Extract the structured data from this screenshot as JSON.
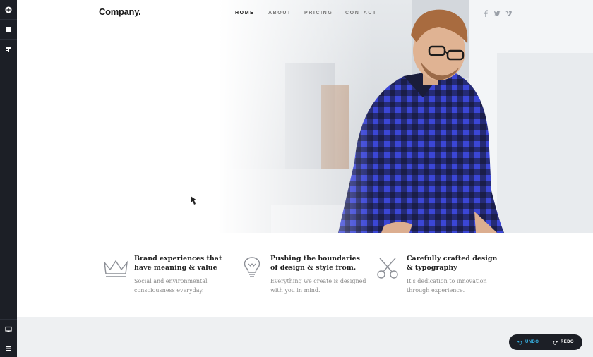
{
  "editor_sidebar": {
    "top_tools": [
      {
        "icon": "add-icon"
      },
      {
        "icon": "layers-icon"
      },
      {
        "icon": "theme-icon"
      }
    ],
    "bottom_tools": [
      {
        "icon": "monitor-icon"
      },
      {
        "icon": "menu-icon"
      }
    ]
  },
  "header": {
    "logo": "Company.",
    "nav": [
      "HOME",
      "ABOUT",
      "PRICING",
      "CONTACT"
    ],
    "active_nav": "HOME",
    "social": [
      "facebook-icon",
      "twitter-icon",
      "vimeo-icon"
    ]
  },
  "features": [
    {
      "icon": "crown-icon",
      "title": "Brand experiences that have meaning & value",
      "text": "Social and environmental consciousness everyday."
    },
    {
      "icon": "lightbulb-icon",
      "title": "Pushing the boundaries of design & style from.",
      "text": "Everything we create is designed with you in mind."
    },
    {
      "icon": "scissors-icon",
      "title": "Carefully crafted design & typography",
      "text": "It's dedication to innovation through experience."
    }
  ],
  "history": {
    "undo_label": "UNDO",
    "redo_label": "REDO"
  },
  "colors": {
    "sidebar": "#1c1f26",
    "accent": "#38b6e8",
    "shirt_blue": "#3d47d8",
    "band": "#eef0f2"
  }
}
